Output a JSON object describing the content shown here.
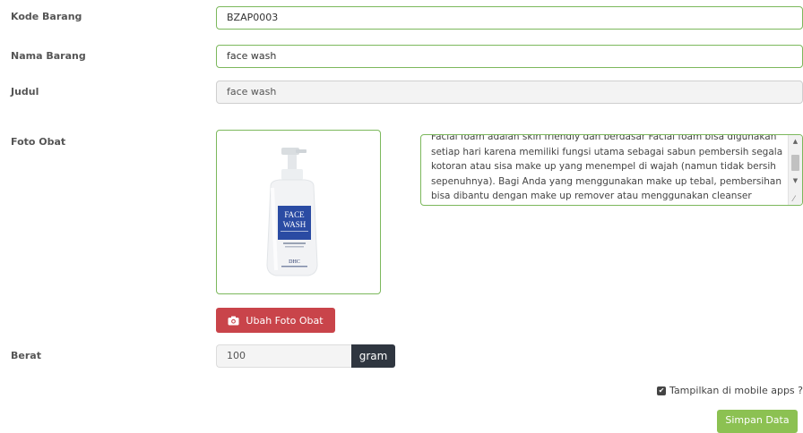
{
  "form": {
    "kode_barang": {
      "label": "Kode Barang",
      "value": "BZAP0003"
    },
    "nama_barang": {
      "label": "Nama Barang",
      "value": "face wash"
    },
    "judul": {
      "label": "Judul",
      "value": "face wash"
    },
    "foto_obat": {
      "label": "Foto Obat",
      "product_name_line1": "FACE",
      "product_name_line2": "WASH",
      "brand": "DHC"
    },
    "description_lines": [
      "Facial foam adalah skin friendly dan berdasar Facial foam bisa digunakan",
      "setiap hari karena memiliki fungsi utama sebagai sabun pembersih segala",
      "kotoran atau sisa make up yang menempel di wajah (namun tidak bersih",
      "sepenuhnya). Bagi Anda yang menggunakan make up tebal, pembersihan",
      "bisa dibantu dengan make up remover atau menggunakan cleanser"
    ],
    "ubah_foto_button": "Ubah Foto Obat",
    "berat": {
      "label": "Berat",
      "value": "100",
      "unit": "gram"
    },
    "mobile_apps_label": "Tampilkan di mobile apps ?",
    "mobile_apps_checked": true,
    "simpan_button": "Simpan Data"
  },
  "colors": {
    "field_border": "#7cb85c",
    "photo_button": "#c9444a",
    "addon": "#2f3640",
    "save_button": "#8cc152"
  }
}
